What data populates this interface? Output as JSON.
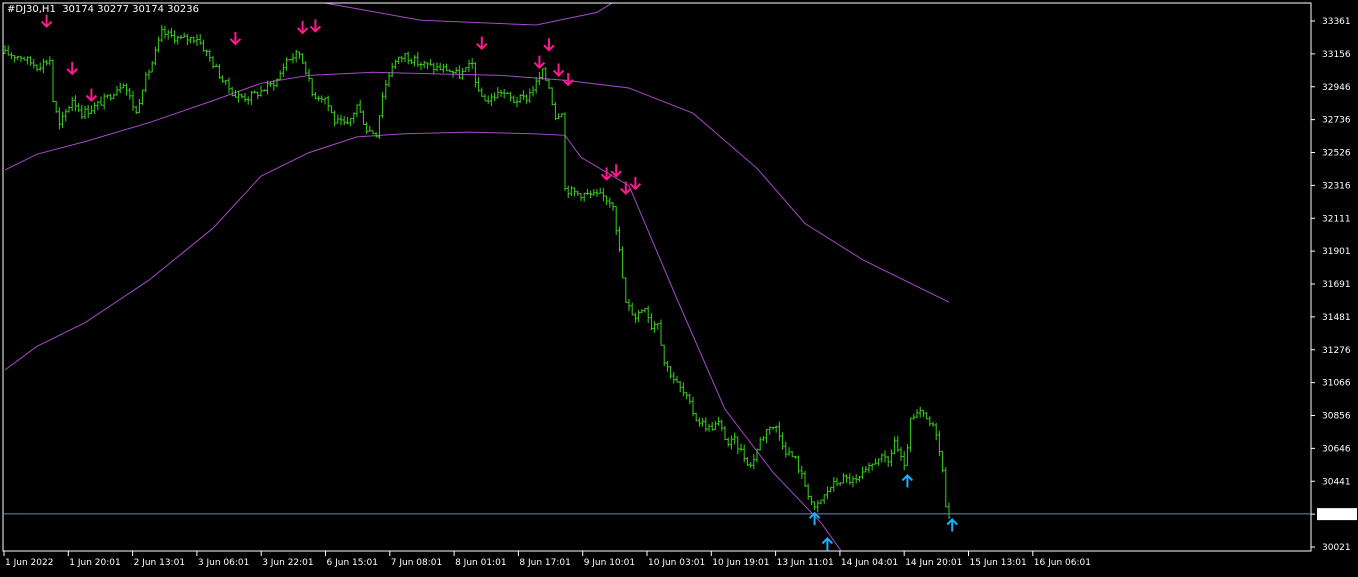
{
  "header": {
    "symbol": "#DJ30,H1",
    "ohlc": "30174 30277 30174 30236"
  },
  "colors": {
    "background": "#000000",
    "axis": "#ffffff",
    "bars": "#39d11a",
    "bands": "#a64ac9",
    "sell_arrow": "#ff1a8c",
    "buy_arrow": "#1ab0ff",
    "price_line": "#6f86c4"
  },
  "chart_data": {
    "type": "ohlc",
    "y_ticks": [
      33361,
      33156,
      32946,
      32736,
      32526,
      32316,
      32111,
      31901,
      31691,
      31481,
      31276,
      31066,
      30856,
      30646,
      30441,
      30236,
      30021
    ],
    "ylim": [
      30000,
      33480
    ],
    "x_ticks": [
      "1 Jun 2022",
      "1 Jun 20:01",
      "2 Jun 13:01",
      "3 Jun 06:01",
      "3 Jun 22:01",
      "6 Jun 15:01",
      "7 Jun 08:01",
      "8 Jun 01:01",
      "8 Jun 17:01",
      "9 Jun 10:01",
      "10 Jun 03:01",
      "10 Jun 19:01",
      "13 Jun 11:01",
      "14 Jun 04:01",
      "14 Jun 20:01",
      "15 Jun 13:01",
      "16 Jun 06:01"
    ],
    "current_price": "30236",
    "close_series": [
      {
        "b": 0,
        "c": 33160
      },
      {
        "b": 5,
        "c": 33140
      },
      {
        "b": 10,
        "c": 33080
      },
      {
        "b": 14,
        "c": 33120
      },
      {
        "b": 15,
        "c": 32860
      },
      {
        "b": 17,
        "c": 32700
      },
      {
        "b": 21,
        "c": 32870
      },
      {
        "b": 24,
        "c": 32780
      },
      {
        "b": 28,
        "c": 32820
      },
      {
        "b": 32,
        "c": 32880
      },
      {
        "b": 37,
        "c": 32980
      },
      {
        "b": 41,
        "c": 32780
      },
      {
        "b": 43,
        "c": 32950
      },
      {
        "b": 46,
        "c": 33100
      },
      {
        "b": 49,
        "c": 33290
      },
      {
        "b": 55,
        "c": 33250
      },
      {
        "b": 60,
        "c": 33260
      },
      {
        "b": 64,
        "c": 33130
      },
      {
        "b": 68,
        "c": 32990
      },
      {
        "b": 72,
        "c": 32890
      },
      {
        "b": 76,
        "c": 32880
      },
      {
        "b": 80,
        "c": 32920
      },
      {
        "b": 85,
        "c": 32990
      },
      {
        "b": 88,
        "c": 33120
      },
      {
        "b": 92,
        "c": 33160
      },
      {
        "b": 94,
        "c": 33060
      },
      {
        "b": 96,
        "c": 32900
      },
      {
        "b": 100,
        "c": 32880
      },
      {
        "b": 103,
        "c": 32730
      },
      {
        "b": 107,
        "c": 32700
      },
      {
        "b": 110,
        "c": 32830
      },
      {
        "b": 113,
        "c": 32680
      },
      {
        "b": 116,
        "c": 32650
      },
      {
        "b": 118,
        "c": 32900
      },
      {
        "b": 121,
        "c": 33090
      },
      {
        "b": 125,
        "c": 33150
      },
      {
        "b": 129,
        "c": 33100
      },
      {
        "b": 134,
        "c": 33070
      },
      {
        "b": 138,
        "c": 33060
      },
      {
        "b": 142,
        "c": 33020
      },
      {
        "b": 146,
        "c": 33090
      },
      {
        "b": 148,
        "c": 32900
      },
      {
        "b": 151,
        "c": 32860
      },
      {
        "b": 155,
        "c": 32920
      },
      {
        "b": 159,
        "c": 32860
      },
      {
        "b": 163,
        "c": 32880
      },
      {
        "b": 166,
        "c": 32970
      },
      {
        "b": 168,
        "c": 33040
      },
      {
        "b": 170,
        "c": 32950
      },
      {
        "b": 172,
        "c": 32760
      },
      {
        "b": 174,
        "c": 32800
      },
      {
        "b": 175,
        "c": 32300
      },
      {
        "b": 179,
        "c": 32270
      },
      {
        "b": 183,
        "c": 32260
      },
      {
        "b": 187,
        "c": 32250
      },
      {
        "b": 190,
        "c": 32210
      },
      {
        "b": 192,
        "c": 31900
      },
      {
        "b": 194,
        "c": 31570
      },
      {
        "b": 197,
        "c": 31490
      },
      {
        "b": 200,
        "c": 31560
      },
      {
        "b": 202,
        "c": 31430
      },
      {
        "b": 204,
        "c": 31460
      },
      {
        "b": 206,
        "c": 31200
      },
      {
        "b": 210,
        "c": 31060
      },
      {
        "b": 213,
        "c": 30970
      },
      {
        "b": 216,
        "c": 30840
      },
      {
        "b": 220,
        "c": 30780
      },
      {
        "b": 223,
        "c": 30810
      },
      {
        "b": 226,
        "c": 30680
      },
      {
        "b": 228,
        "c": 30700
      },
      {
        "b": 231,
        "c": 30600
      },
      {
        "b": 233,
        "c": 30540
      },
      {
        "b": 236,
        "c": 30700
      },
      {
        "b": 239,
        "c": 30800
      },
      {
        "b": 241,
        "c": 30780
      },
      {
        "b": 244,
        "c": 30640
      },
      {
        "b": 247,
        "c": 30580
      },
      {
        "b": 250,
        "c": 30420
      },
      {
        "b": 253,
        "c": 30260
      },
      {
        "b": 256,
        "c": 30350
      },
      {
        "b": 258,
        "c": 30410
      },
      {
        "b": 262,
        "c": 30460
      },
      {
        "b": 266,
        "c": 30440
      },
      {
        "b": 270,
        "c": 30520
      },
      {
        "b": 273,
        "c": 30600
      },
      {
        "b": 276,
        "c": 30560
      },
      {
        "b": 278,
        "c": 30700
      },
      {
        "b": 281,
        "c": 30520
      },
      {
        "b": 283,
        "c": 30820
      },
      {
        "b": 286,
        "c": 30880
      },
      {
        "b": 288,
        "c": 30830
      },
      {
        "b": 291,
        "c": 30760
      },
      {
        "b": 293,
        "c": 30500
      },
      {
        "b": 294,
        "c": 30300
      },
      {
        "b": 295,
        "c": 30236
      }
    ],
    "upper_band": [
      {
        "b": 0,
        "v": 35150
      },
      {
        "b": 80,
        "v": 34500
      },
      {
        "b": 100,
        "v": 33480
      },
      {
        "b": 130,
        "v": 33370
      },
      {
        "b": 166,
        "v": 33340
      },
      {
        "b": 185,
        "v": 33420
      },
      {
        "b": 196,
        "v": 33560
      }
    ],
    "middle_band": [
      {
        "b": 0,
        "v": 32420
      },
      {
        "b": 10,
        "v": 32520
      },
      {
        "b": 25,
        "v": 32600
      },
      {
        "b": 45,
        "v": 32720
      },
      {
        "b": 65,
        "v": 32860
      },
      {
        "b": 80,
        "v": 32970
      },
      {
        "b": 95,
        "v": 33020
      },
      {
        "b": 115,
        "v": 33040
      },
      {
        "b": 135,
        "v": 33030
      },
      {
        "b": 155,
        "v": 33020
      },
      {
        "b": 175,
        "v": 32990
      },
      {
        "b": 195,
        "v": 32940
      },
      {
        "b": 215,
        "v": 32780
      },
      {
        "b": 235,
        "v": 32430
      },
      {
        "b": 250,
        "v": 32080
      },
      {
        "b": 268,
        "v": 31850
      },
      {
        "b": 285,
        "v": 31680
      },
      {
        "b": 295,
        "v": 31580
      }
    ],
    "lower_band": [
      {
        "b": 0,
        "v": 31150
      },
      {
        "b": 10,
        "v": 31300
      },
      {
        "b": 25,
        "v": 31450
      },
      {
        "b": 45,
        "v": 31720
      },
      {
        "b": 65,
        "v": 32050
      },
      {
        "b": 80,
        "v": 32380
      },
      {
        "b": 95,
        "v": 32530
      },
      {
        "b": 110,
        "v": 32630
      },
      {
        "b": 125,
        "v": 32650
      },
      {
        "b": 145,
        "v": 32660
      },
      {
        "b": 165,
        "v": 32650
      },
      {
        "b": 175,
        "v": 32640
      },
      {
        "b": 180,
        "v": 32500
      },
      {
        "b": 195,
        "v": 32320
      },
      {
        "b": 210,
        "v": 31600
      },
      {
        "b": 225,
        "v": 30900
      },
      {
        "b": 240,
        "v": 30500
      },
      {
        "b": 255,
        "v": 30180
      },
      {
        "b": 262,
        "v": 29980
      }
    ],
    "sell_signals": [
      13,
      21,
      27,
      72,
      93,
      97,
      149,
      167,
      170,
      173,
      176,
      188,
      191,
      194,
      197
    ],
    "sell_signals_price": [
      33330,
      33030,
      32860,
      33220,
      33290,
      33300,
      33190,
      33070,
      33180,
      33020,
      32960,
      32360,
      32380,
      32270,
      32300
    ],
    "buy_signals": [
      253,
      257,
      282,
      296
    ],
    "buy_signals_price": [
      30240,
      30080,
      30480,
      30200
    ]
  }
}
